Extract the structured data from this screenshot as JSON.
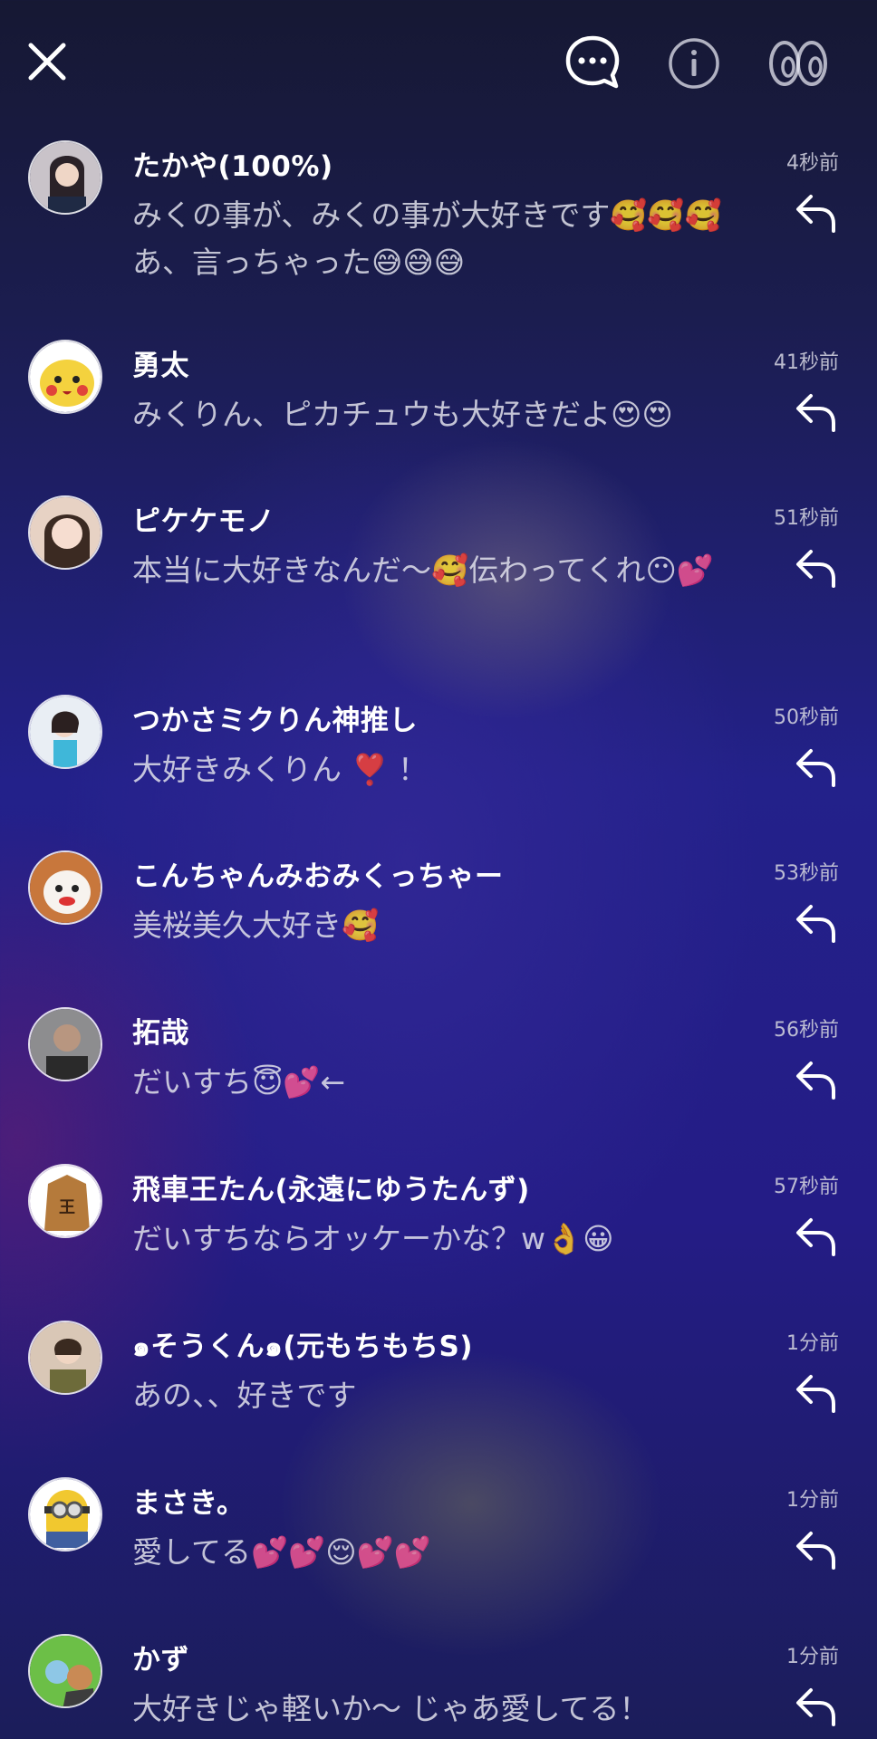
{
  "header": {
    "close_icon": "close-icon",
    "chat_icon": "chat-bubble-icon",
    "info_icon": "info-icon",
    "view_icon": "eyes-icon"
  },
  "comments": [
    {
      "user": "たかや(100%)",
      "time": "4秒前",
      "message": "みくの事が、みくの事が大好きです🥰🥰🥰 あ、言っちゃった😅😅😅",
      "avatar_color": "#c9c3c9"
    },
    {
      "user": "勇太",
      "time": "41秒前",
      "message": "みくりん、ピカチュウも大好きだよ😍😍",
      "avatar_color": "#f4d23e"
    },
    {
      "user": "ピケケモノ",
      "time": "51秒前",
      "message": "本当に大好きなんだ〜🥰伝わってくれ😶💕",
      "avatar_color": "#e7d2c4"
    },
    {
      "user": "つかさミクりん神推し",
      "time": "50秒前",
      "message": "大好きみくりん ❣️ ！",
      "avatar_color": "#e9eef4"
    },
    {
      "user": "こんちゃんみおみくっちゃー",
      "time": "53秒前",
      "message": "美桜美久大好き🥰",
      "avatar_color": "#c8773c"
    },
    {
      "user": "拓哉",
      "time": "56秒前",
      "message": "だいすち😇💕←",
      "avatar_color": "#8d8d8f"
    },
    {
      "user": "飛車王たん(永遠にゆうたんず)",
      "time": "57秒前",
      "message": "だいすちならオッケーかな？w👌😀",
      "avatar_color": "#b57a3b"
    },
    {
      "user": "๑そうくん๑(元もちもちS)",
      "time": "1分前",
      "message": "あの、、好きです",
      "avatar_color": "#d9c7b6"
    },
    {
      "user": "まさき。",
      "time": "1分前",
      "message": "愛してる💕💕😌💕💕",
      "avatar_color": "#f1c82f"
    },
    {
      "user": "かず",
      "time": "1分前",
      "message": "大好きじゃ軽いか〜 じゃあ愛してる！",
      "avatar_color": "#6cbf47"
    }
  ]
}
